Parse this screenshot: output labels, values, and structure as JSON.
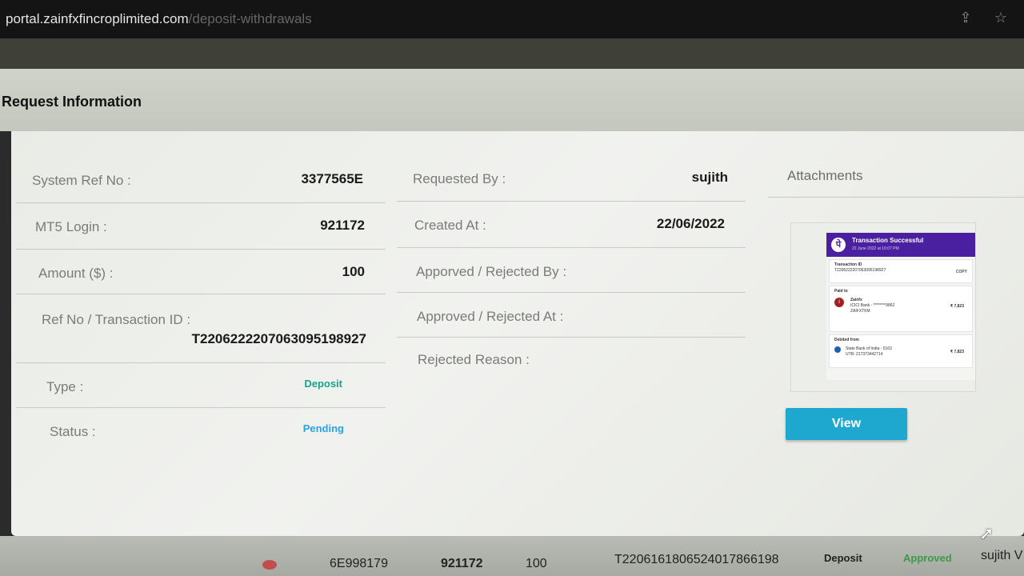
{
  "browser": {
    "url_host": "portal.zainfxfincroplimited.com",
    "url_path": "/deposit-withdrawals",
    "icons": [
      "share-icon",
      "star-icon"
    ]
  },
  "panel": {
    "title": "Request Information"
  },
  "left_fields": {
    "system_ref": {
      "label": "System Ref No :",
      "value": "3377565E"
    },
    "mt5_login": {
      "label": "MT5 Login :",
      "value": "921172"
    },
    "amount": {
      "label": "Amount ($) :",
      "value": "100"
    },
    "ref_no": {
      "label": "Ref No / Transaction ID :",
      "value": "T2206222207063095198927"
    },
    "type": {
      "label": "Type :",
      "value": "Deposit"
    },
    "status": {
      "label": "Status :",
      "value": "Pending"
    }
  },
  "middle_fields": {
    "requested_by": {
      "label": "Requested By :",
      "value": "sujith"
    },
    "created_at": {
      "label": "Created At :",
      "value": "22/06/2022"
    },
    "approved_by": {
      "label": "Apporved / Rejected By :",
      "value": ""
    },
    "approved_at": {
      "label": "Approved / Rejected At :",
      "value": ""
    },
    "rejected_reason": {
      "label": "Rejected Reason :",
      "value": ""
    }
  },
  "attachments": {
    "title": "Attachments",
    "receipt": {
      "header_title": "Transaction Successful",
      "header_sub": "22 June 2022 at 10:07 PM",
      "txn_label": "Transaction ID",
      "txn_value": "T2206222207063095198927",
      "copy": "COPY",
      "paid_to_label": "Paid to",
      "paid_to_name": "Zainfx",
      "paid_to_bank": "ICICI Bank - ********9862",
      "paid_to_extra": "ZAIFXTKM",
      "paid_amount": "₹ 7,823",
      "debited_label": "Debited from",
      "debited_bank": "State Bank of India - 5163",
      "debited_utr": "UTR: 217373442714",
      "debited_amount": "₹ 7,823"
    },
    "view_button": "View"
  },
  "bottom_row": {
    "ref": "6E998179",
    "login": "921172",
    "amount": "100",
    "txn": "T2206161806524017866198",
    "type": "Deposit",
    "status": "Approved",
    "user": "sujith V"
  },
  "colors": {
    "deposit": "#1aa389",
    "pending": "#2ba3e0",
    "approved": "#3a9a4a",
    "view_button": "#1fa8cf",
    "receipt_header": "#4a1fa0"
  }
}
